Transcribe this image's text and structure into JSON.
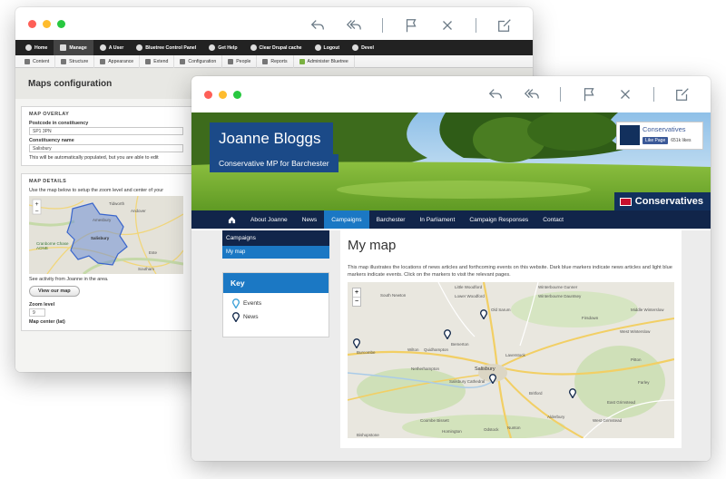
{
  "back_window": {
    "toolbar": {
      "items": [
        "Home",
        "Manage",
        "A User",
        "Bluetree Control Panel",
        "Get Help",
        "Clear Drupal cache",
        "Logout",
        "Devel"
      ]
    },
    "subtoolbar": {
      "items": [
        "Content",
        "Structure",
        "Appearance",
        "Extend",
        "Configuration",
        "People",
        "Reports",
        "Administer Bluetree"
      ]
    },
    "page_title": "Maps configuration",
    "map_overlay": {
      "heading": "MAP OVERLAY",
      "postcode_label": "Postcode in constituency",
      "postcode_value": "SP1 3PN",
      "constituency_label": "Constituency name",
      "constituency_value": "Salisbury",
      "help": "This will be automatically populated, but you are able to edit"
    },
    "map_details": {
      "heading": "MAP DETAILS",
      "help": "Use the map below to setup the zoom level and center of your",
      "map_labels": [
        "Tidworth",
        "Andover",
        "Amesbury",
        "Salisbury",
        "Cranborne Chase AONB",
        "Southam",
        "Este"
      ],
      "activity_text": "See activity from Joanne in the area.",
      "view_button": "View our map",
      "zoom_label": "Zoom level",
      "zoom_value": "9",
      "map_center_label": "Map center (lat)"
    }
  },
  "front_window": {
    "hero": {
      "name": "Joanne Bloggs",
      "subtitle": "Conservative MP for Barchester",
      "facebook": {
        "page_name": "Conservatives",
        "like_label": "Like Page",
        "likes": "651k likes"
      },
      "party_logo": "Conservatives"
    },
    "nav": {
      "items": [
        "About Joanne",
        "News",
        "Campaigns",
        "Barchester",
        "In Parliament",
        "Campaign Responses",
        "Contact"
      ],
      "active": "Campaigns"
    },
    "sidebar": {
      "section": "Campaigns",
      "items": [
        "My map"
      ]
    },
    "key": {
      "title": "Key",
      "items": [
        "Events",
        "News"
      ]
    },
    "main": {
      "title": "My map",
      "description": "This map illustrates the locations of news articles and forthcoming events on this website. Dark blue markers indicate news articles and light blue markers indicate events. Click on the markers to visit the relevant pages.",
      "map_labels": [
        "South Newton",
        "Little Woodford",
        "Lower Woodford",
        "Winterbourne Gunner",
        "Winterbourne Dauntsey",
        "Old Sarum",
        "Firsdown",
        "Middle Winterslow",
        "West Winterslow",
        "Wilton",
        "Quidhampton",
        "Bemerton",
        "Laverstock",
        "Netherhampton",
        "Burcombe",
        "Salisbury",
        "Salisbury Cathedral",
        "Pitton",
        "Farley",
        "Britford",
        "East Grimstead",
        "West Grimstead",
        "Alderbury",
        "Coombe Bissett",
        "Homington",
        "Odstock",
        "Nunton",
        "Bishopstone"
      ]
    }
  },
  "colors": {
    "navy": "#11254a",
    "blue": "#1b78c4",
    "plate": "#1b4a88"
  }
}
